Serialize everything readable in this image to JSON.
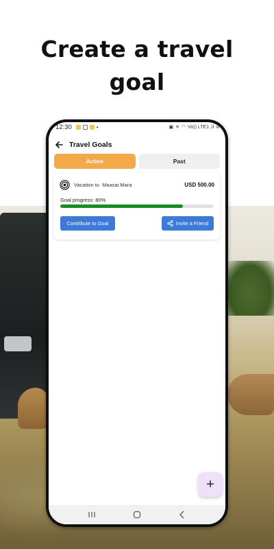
{
  "headline": "Create a travel goal",
  "status_bar": {
    "time": "12:30",
    "network": "Vo)) LTE1 .il"
  },
  "header": {
    "title": "Travel Goals",
    "back_icon": "arrow-left-icon"
  },
  "tabs": [
    {
      "label": "Active",
      "selected": true
    },
    {
      "label": "Past",
      "selected": false
    }
  ],
  "goal": {
    "prefix": "Vacation to",
    "destination": "Maasai Mara",
    "amount": "USD 500.00",
    "progress_label": "Goal progress: 80%",
    "progress_value": 0.8,
    "contribute_label": "Contribute to Goal",
    "invite_label": "Invite a Friend",
    "icon": "target-icon",
    "invite_icon": "share-icon"
  },
  "fab": {
    "label": "+"
  },
  "colors": {
    "active_tab": "#f3a94a",
    "primary_button": "#3e7bd8",
    "progress": "#1a8a24",
    "fab": "#efe0fb"
  }
}
